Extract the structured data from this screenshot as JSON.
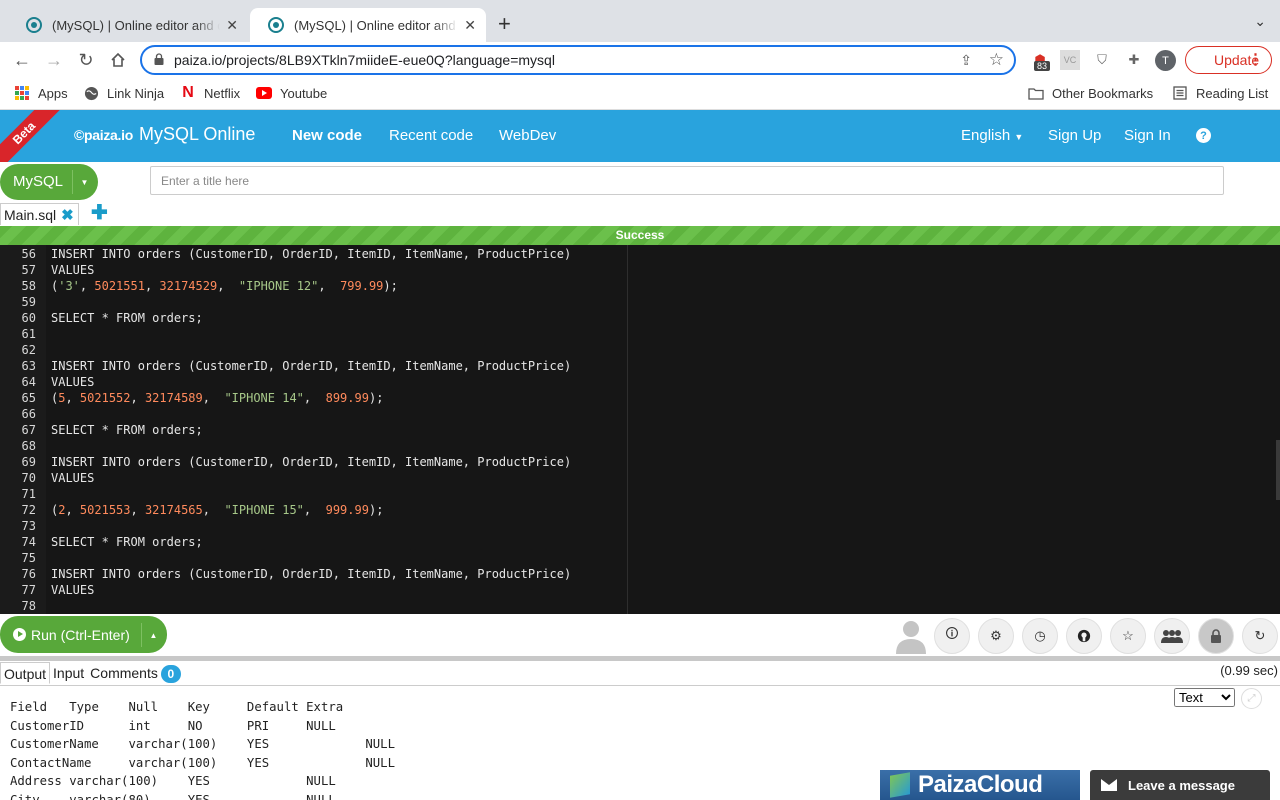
{
  "browser": {
    "tabs": [
      {
        "title": "(MySQL) | Online editor and compiler"
      },
      {
        "title": "(MySQL) | Online editor and compiler"
      }
    ],
    "url": "paiza.io/projects/8LB9XTkln7miideE-eue0Q?language=mysql",
    "extension_badge": "83",
    "profile_initial": "T",
    "update_label": "Update",
    "bookmarks": [
      {
        "label": "Apps"
      },
      {
        "label": "Link Ninja"
      },
      {
        "label": "Netflix"
      },
      {
        "label": "Youtube"
      }
    ],
    "other_bookmarks": "Other Bookmarks",
    "reading_list": "Reading List"
  },
  "header": {
    "beta": "Beta",
    "logo": "©paiza.io",
    "app_name": "MySQL Online",
    "nav": [
      "New code",
      "Recent code",
      "WebDev"
    ],
    "language": "English",
    "sign_up": "Sign Up",
    "sign_in": "Sign In",
    "help": "?"
  },
  "editor_bar": {
    "language": "MySQL",
    "title_placeholder": "Enter a title here",
    "file_tab": "Main.sql",
    "status": "Success"
  },
  "code_lines": [
    {
      "n": "56",
      "parts": [
        [
          "kw",
          "INSERT INTO orders (CustomerID, OrderID, ItemID, ItemName, ProductPrice)"
        ]
      ]
    },
    {
      "n": "57",
      "parts": [
        [
          "kw",
          "VALUES"
        ]
      ]
    },
    {
      "n": "58",
      "parts": [
        [
          "kw",
          "("
        ],
        [
          "str",
          "'3'"
        ],
        [
          "kw",
          ", "
        ],
        [
          "num",
          "5021551"
        ],
        [
          "kw",
          ", "
        ],
        [
          "num",
          "32174529"
        ],
        [
          "kw",
          ",  "
        ],
        [
          "str",
          "\"IPHONE 12\""
        ],
        [
          "kw",
          ",  "
        ],
        [
          "num",
          "799.99"
        ],
        [
          "kw",
          ");"
        ]
      ]
    },
    {
      "n": "59",
      "parts": []
    },
    {
      "n": "60",
      "parts": [
        [
          "kw",
          "SELECT * FROM orders;"
        ]
      ]
    },
    {
      "n": "61",
      "parts": []
    },
    {
      "n": "62",
      "parts": []
    },
    {
      "n": "63",
      "parts": [
        [
          "kw",
          "INSERT INTO orders (CustomerID, OrderID, ItemID, ItemName, ProductPrice)"
        ]
      ]
    },
    {
      "n": "64",
      "parts": [
        [
          "kw",
          "VALUES"
        ]
      ]
    },
    {
      "n": "65",
      "parts": [
        [
          "kw",
          "("
        ],
        [
          "num",
          "5"
        ],
        [
          "kw",
          ", "
        ],
        [
          "num",
          "5021552"
        ],
        [
          "kw",
          ", "
        ],
        [
          "num",
          "32174589"
        ],
        [
          "kw",
          ",  "
        ],
        [
          "str",
          "\"IPHONE 14\""
        ],
        [
          "kw",
          ",  "
        ],
        [
          "num",
          "899.99"
        ],
        [
          "kw",
          ");"
        ]
      ]
    },
    {
      "n": "66",
      "parts": []
    },
    {
      "n": "67",
      "parts": [
        [
          "kw",
          "SELECT * FROM orders;"
        ]
      ]
    },
    {
      "n": "68",
      "parts": []
    },
    {
      "n": "69",
      "parts": [
        [
          "kw",
          "INSERT INTO orders (CustomerID, OrderID, ItemID, ItemName, ProductPrice)"
        ]
      ]
    },
    {
      "n": "70",
      "parts": [
        [
          "kw",
          "VALUES"
        ]
      ]
    },
    {
      "n": "71",
      "parts": []
    },
    {
      "n": "72",
      "parts": [
        [
          "kw",
          "("
        ],
        [
          "num",
          "2"
        ],
        [
          "kw",
          ", "
        ],
        [
          "num",
          "5021553"
        ],
        [
          "kw",
          ", "
        ],
        [
          "num",
          "32174565"
        ],
        [
          "kw",
          ",  "
        ],
        [
          "str",
          "\"IPHONE 15\""
        ],
        [
          "kw",
          ",  "
        ],
        [
          "num",
          "999.99"
        ],
        [
          "kw",
          ");"
        ]
      ]
    },
    {
      "n": "73",
      "parts": []
    },
    {
      "n": "74",
      "parts": [
        [
          "kw",
          "SELECT * FROM orders;"
        ]
      ]
    },
    {
      "n": "75",
      "parts": []
    },
    {
      "n": "76",
      "parts": [
        [
          "kw",
          "INSERT INTO orders (CustomerID, OrderID, ItemID, ItemName, ProductPrice)"
        ]
      ]
    },
    {
      "n": "77",
      "parts": [
        [
          "kw",
          "VALUES"
        ]
      ]
    },
    {
      "n": "78",
      "parts": []
    }
  ],
  "run_bar": {
    "run_label": "Run (Ctrl-Enter)",
    "tools": [
      "info-icon",
      "gear-icon",
      "clock-icon",
      "github-icon",
      "star-icon",
      "group-icon",
      "lock-icon",
      "refresh-icon"
    ]
  },
  "output": {
    "tabs": [
      "Output",
      "Input",
      "Comments"
    ],
    "comments_count": "0",
    "exec_time": "(0.99 sec)",
    "format": "Text",
    "text": "Field\tType\tNull\tKey\tDefault\tExtra\nCustomerID\tint\tNO\tPRI\tNULL\nCustomerName\tvarchar(100)\tYES\t\tNULL\nContactName\tvarchar(100)\tYES\t\tNULL\nAddress\tvarchar(100)\tYES\t\tNULL\nCity\tvarchar(80)\tYES\t\tNULL"
  },
  "footer": {
    "cloud_banner": "PaizaCloud",
    "message_button": "Leave a message"
  }
}
